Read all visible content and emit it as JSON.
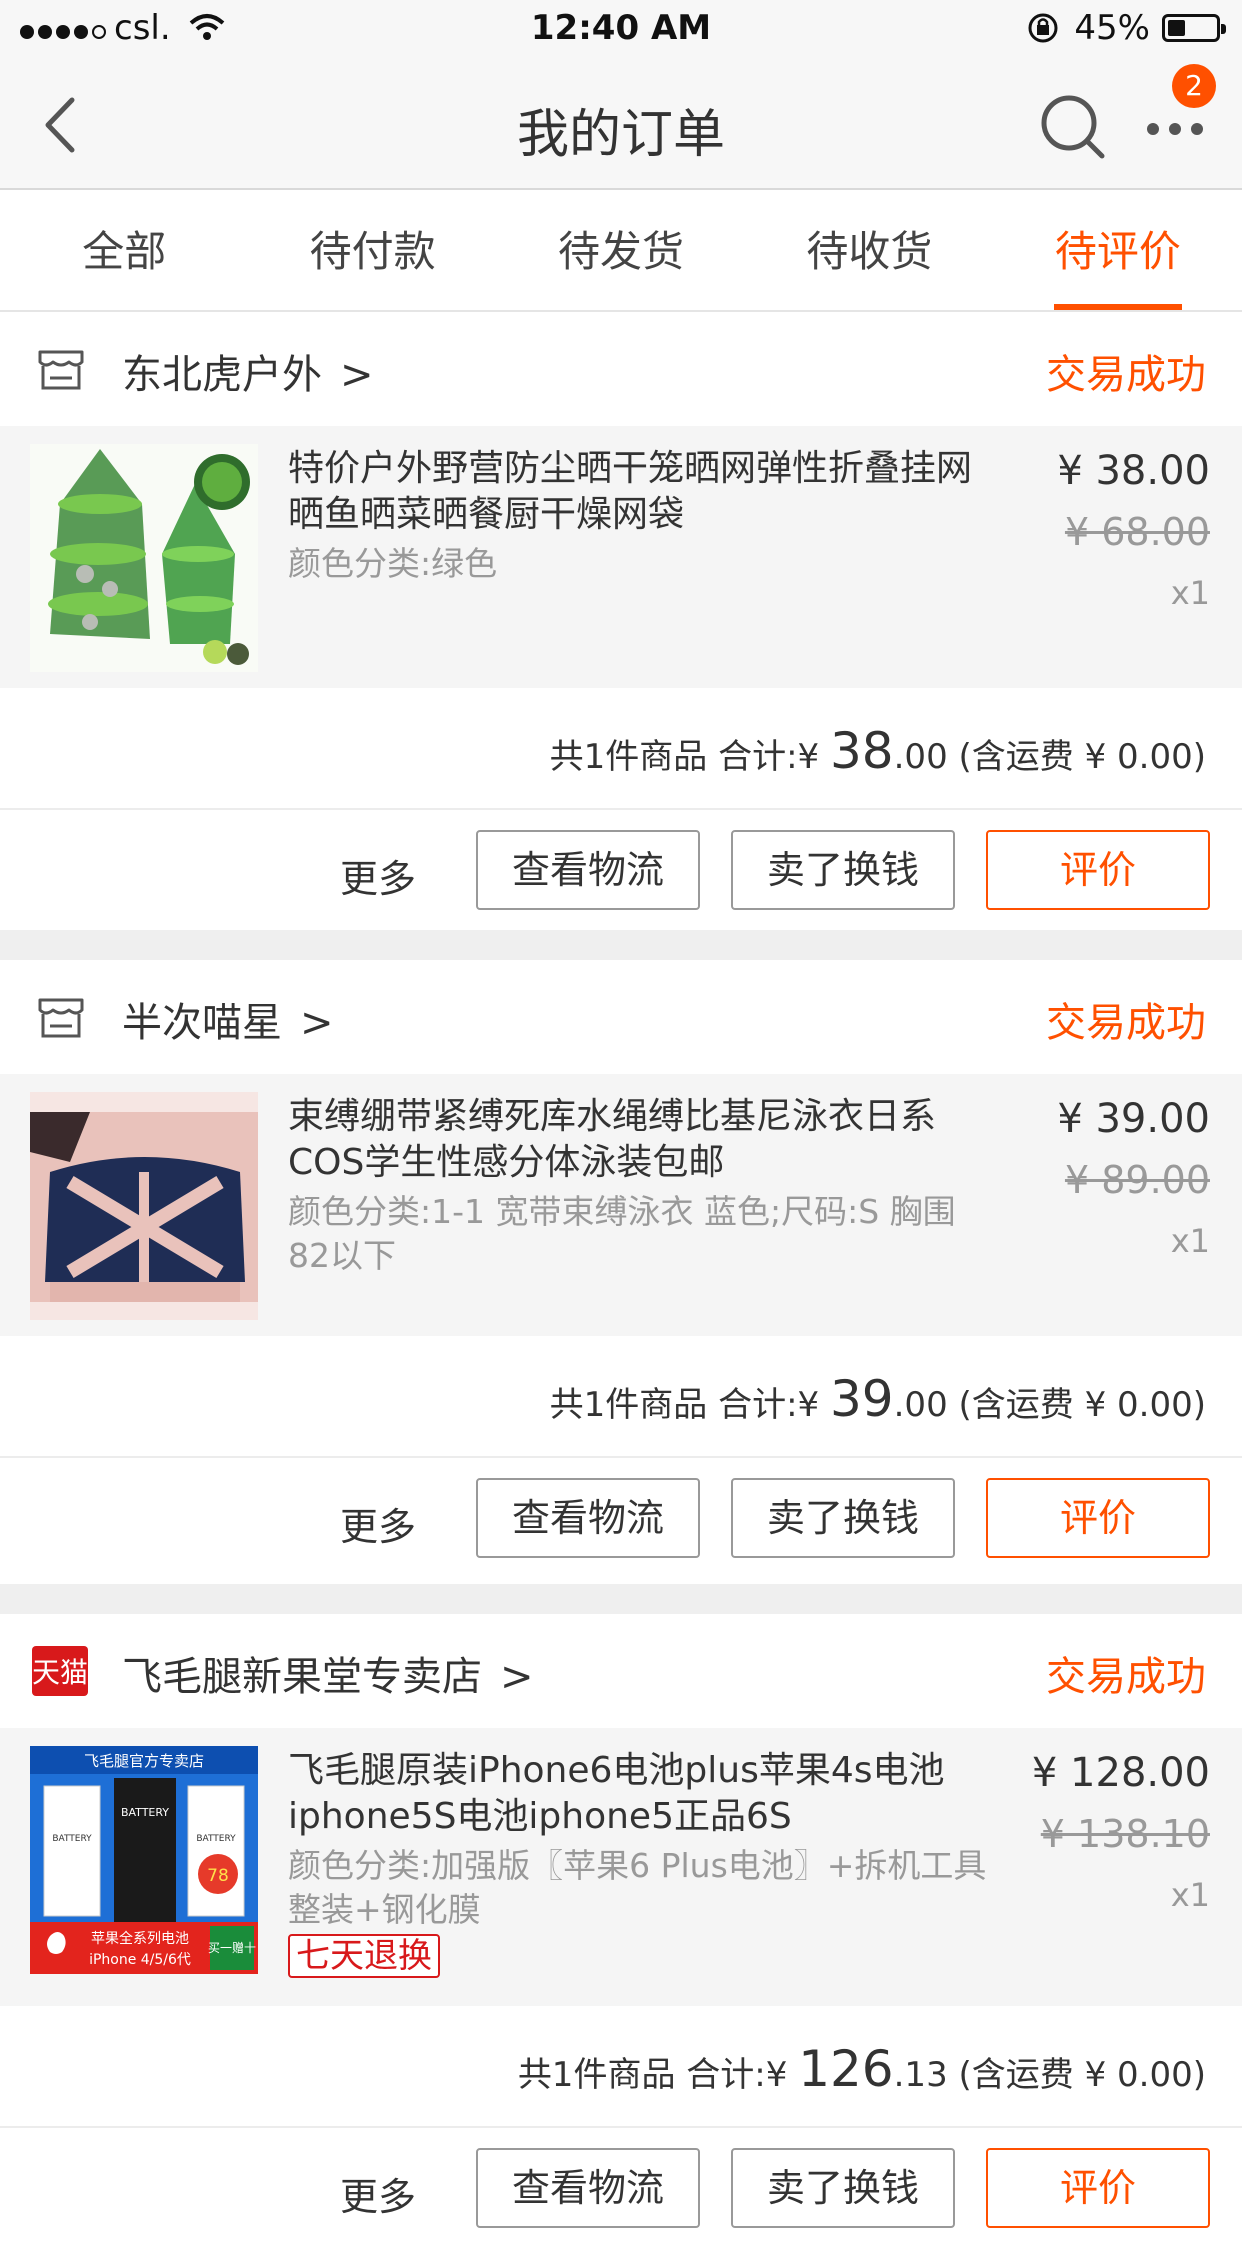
{
  "status_bar": {
    "carrier": "csl.",
    "time": "12:40 AM",
    "battery_percent": "45%",
    "battery_level": 0.45
  },
  "nav": {
    "title": "我的订单",
    "badge_count": "2"
  },
  "tabs": [
    {
      "label": "全部",
      "active": false
    },
    {
      "label": "待付款",
      "active": false
    },
    {
      "label": "待发货",
      "active": false
    },
    {
      "label": "待收货",
      "active": false
    },
    {
      "label": "待评价",
      "active": true
    }
  ],
  "orders": [
    {
      "shop": {
        "name": "东北虎户外",
        "type": "store",
        "icon": "store-icon"
      },
      "status": "交易成功",
      "item": {
        "title": "特价户外野营防尘晒干笼晒网弹性折叠挂网晒鱼晒菜晒餐厨干燥网袋",
        "sku": "颜色分类:绿色",
        "price": "¥ 38.00",
        "original_price": "¥ 68.00",
        "qty": "x1",
        "tag": ""
      },
      "summary": {
        "count_text": "共1件商品",
        "total_label": "合计:",
        "currency": "¥",
        "total_int": "38",
        "total_dec": ".00",
        "shipping": "(含运费 ¥ 0.00)"
      },
      "actions": {
        "more": "更多",
        "logistics": "查看物流",
        "resell": "卖了换钱",
        "review": "评价"
      }
    },
    {
      "shop": {
        "name": "半次喵星",
        "type": "store",
        "icon": "store-icon"
      },
      "status": "交易成功",
      "item": {
        "title": "束缚绷带紧缚死库水绳缚比基尼泳衣日系COS学生性感分体泳装包邮",
        "sku": "颜色分类:1-1 宽带束缚泳衣 蓝色;尺码:S 胸围82以下",
        "price": "¥ 39.00",
        "original_price": "¥ 89.00",
        "qty": "x1",
        "tag": ""
      },
      "summary": {
        "count_text": "共1件商品",
        "total_label": "合计:",
        "currency": "¥",
        "total_int": "39",
        "total_dec": ".00",
        "shipping": "(含运费 ¥ 0.00)"
      },
      "actions": {
        "more": "更多",
        "logistics": "查看物流",
        "resell": "卖了换钱",
        "review": "评价"
      }
    },
    {
      "shop": {
        "name": "飞毛腿新果堂专卖店",
        "type": "tmall",
        "icon": "tmall-icon",
        "icon_text": "天猫"
      },
      "status": "交易成功",
      "item": {
        "title": "飞毛腿原装iPhone6电池plus苹果4s电池iphone5S电池iphone5正品6S",
        "sku": "颜色分类:加强版〖苹果6 Plus电池〗+拆机工具整装+钢化膜",
        "price": "¥ 128.00",
        "original_price": "¥ 138.10",
        "qty": "x1",
        "tag": "七天退换",
        "thumb_texts": {
          "header": "飞毛腿官方专卖店",
          "label": "BATTERY",
          "bottom1": "苹果全系列电池",
          "bottom2": "iPhone 4/5/6代",
          "gift": "买一赠十",
          "price_badge": "78"
        }
      },
      "summary": {
        "count_text": "共1件商品",
        "total_label": "合计:",
        "currency": "¥",
        "total_int": "126",
        "total_dec": ".13",
        "shipping": "(含运费 ¥ 0.00)"
      },
      "actions": {
        "more": "更多",
        "logistics": "查看物流",
        "resell": "卖了换钱",
        "review": "评价"
      }
    }
  ],
  "colors": {
    "accent": "#ff5000",
    "tmall_red": "#d8191b",
    "muted": "#999999",
    "item_bg": "#f5f5f5"
  }
}
